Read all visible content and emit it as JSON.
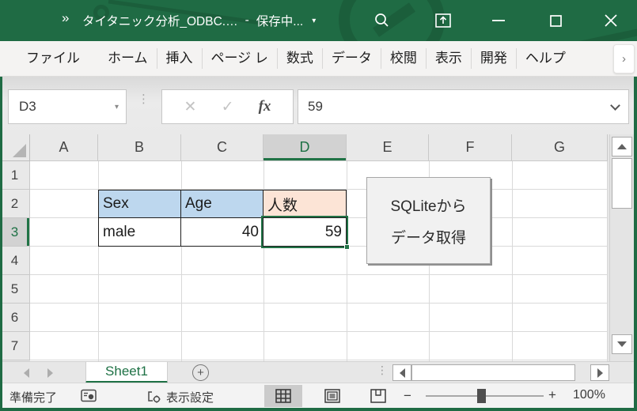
{
  "colors": {
    "title_green": "#1f6b44",
    "selection_green": "#217346",
    "cell_fill_blue": "#BDD7EE",
    "cell_fill_peach": "#FCE4D6"
  },
  "titlebar": {
    "quick_access_overflow": "»",
    "document_title": "タイタニック分析_ODBC.…",
    "separator": "-",
    "save_status": "保存中...",
    "title_dropdown": "▾"
  },
  "ribbon": {
    "tabs": [
      "ファイル",
      "ホーム",
      "挿入",
      "ページ レ",
      "数式",
      "データ",
      "校閲",
      "表示",
      "開発",
      "ヘルプ"
    ],
    "expand_chevron": "›"
  },
  "formula": {
    "name_box_value": "D3",
    "name_box_dropdown": "▾",
    "cancel_glyph": "✕",
    "enter_glyph": "✓",
    "fx_glyph": "fx",
    "bar_value": "59",
    "dots": "⋮"
  },
  "grid": {
    "columns": [
      "A",
      "B",
      "C",
      "D",
      "E",
      "F",
      "G"
    ],
    "rows": [
      "1",
      "2",
      "3",
      "4",
      "5",
      "6",
      "7"
    ],
    "selected_cell": "D3",
    "cells": {
      "B2": "Sex",
      "C2": "Age",
      "D2": "人数",
      "B3": "male",
      "C3": "40",
      "D3": "59"
    }
  },
  "macro_button": {
    "line1": "SQLiteから",
    "line2": "データ取得"
  },
  "sheets": {
    "active_tab": "Sheet1",
    "add_glyph": "+",
    "dots": "⋮"
  },
  "status": {
    "ready": "準備完了",
    "display_settings": "表示設定",
    "zoom_minus": "−",
    "zoom_plus": "+",
    "zoom_level": "100%"
  }
}
